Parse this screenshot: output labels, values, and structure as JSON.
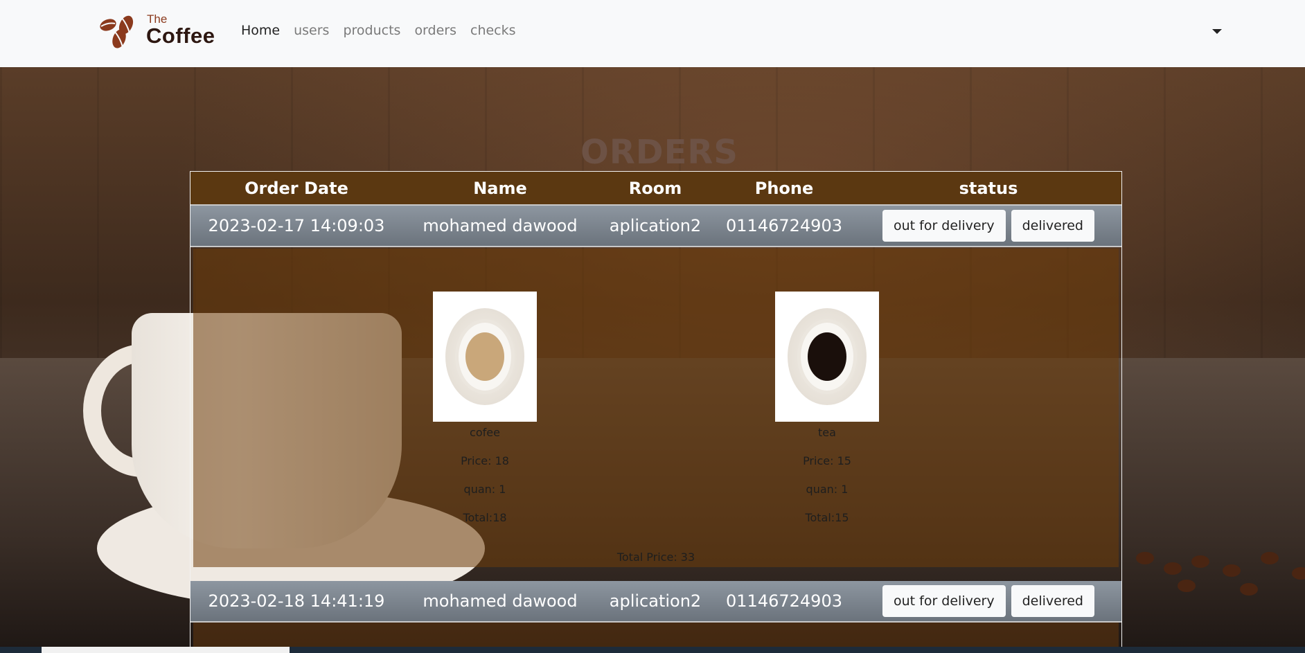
{
  "brand": {
    "top": "The",
    "name": "Coffee"
  },
  "nav": {
    "items": [
      {
        "label": "Home",
        "active": true
      },
      {
        "label": "users",
        "active": false
      },
      {
        "label": "products",
        "active": false
      },
      {
        "label": "orders",
        "active": false
      },
      {
        "label": "checks",
        "active": false
      }
    ]
  },
  "page": {
    "title": "ORDERS"
  },
  "table": {
    "headers": {
      "date": "Order Date",
      "name": "Name",
      "room": "Room",
      "phone": "Phone",
      "status": "status"
    },
    "orders": [
      {
        "date": "2023-02-17 14:09:03",
        "name": "mohamed dawood",
        "room": "aplication2",
        "phone": "01146724903",
        "buttons": {
          "out": "out for delivery",
          "delivered": "delivered"
        },
        "products": [
          {
            "name": "cofee",
            "price": "Price: 18",
            "quan": "quan: 1",
            "total": "Total:18",
            "liquid": "#c9a77a"
          },
          {
            "name": "tea",
            "price": "Price: 15",
            "quan": "quan: 1",
            "total": "Total:15",
            "liquid": "#1a0f0b"
          }
        ],
        "total_price": "Total Price: 33"
      },
      {
        "date": "2023-02-18 14:41:19",
        "name": "mohamed dawood",
        "room": "aplication2",
        "phone": "01146724903",
        "buttons": {
          "out": "out for delivery",
          "delivered": "delivered"
        }
      }
    ]
  },
  "colors": {
    "header_bg": "#5b3811",
    "row_bg": "#7c858e",
    "title": "#6d5245"
  }
}
